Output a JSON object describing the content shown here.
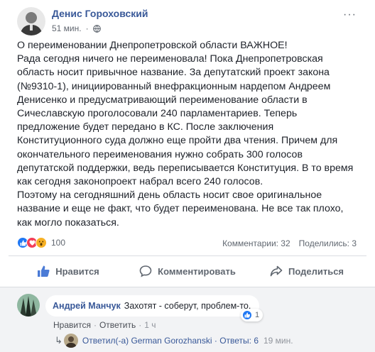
{
  "post": {
    "author": "Денис Гороховский",
    "time": "51 мин.",
    "more": "···",
    "body_lines": [
      "О переименовании Днепропетровской области ВАЖНОЕ!",
      "Рада сегодня ничего не переименовала! Пока Днепропетровская",
      "область носит привычное название. За депутатский проект закона",
      "(№9310-1), инициированный внефракционным нардепом Андреем",
      "Денисенко и предусматривающий переименование области в",
      "Сичеславскую проголосовали 240 парламентариев. Теперь",
      "предложение будет передано в КС. После заключения",
      "Конституционного суда должно еще пройти два чтения. Причем для",
      "окончательного переименования нужно собрать 300 голосов",
      "депутатской поддержки, ведь переписывается Конституция. В то время",
      "как сегодня законопроект набрал всего 240 голосов.",
      "Поэтому на сегодняшний день область носит свое оригинальное",
      "название и еще не факт, что будет переименована. Не все так плохо,",
      "как могло показаться."
    ],
    "reactions_count": "100",
    "comments_count": "Комментарии: 32",
    "shares_count": "Поделились: 3"
  },
  "actions": {
    "like": "Нравится",
    "comment": "Комментировать",
    "share": "Поделиться"
  },
  "comment": {
    "author": "Андрей Манчук",
    "text": "Захотят - соберут, проблем-то.",
    "likes": "1",
    "like_link": "Нравится",
    "reply_link": "Ответить",
    "time": "1 ч",
    "sep": "·"
  },
  "reply": {
    "text": "Ответил(-а) German Gorozhanski",
    "separator": "·",
    "count": "Ответы: 6",
    "time": "19 мин."
  },
  "colors": {
    "link": "#385898",
    "secondary": "#606770",
    "like_blue": "#2078f4"
  }
}
